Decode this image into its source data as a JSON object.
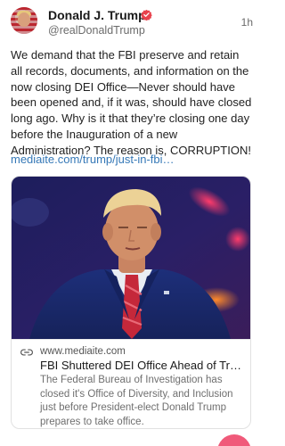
{
  "post": {
    "display_name": "Donald J. Trump",
    "handle": "@realDonaldTrump",
    "time": "1h",
    "text": "We demand that the FBI preserve and retain all records, documents, and information on the now closing DEI Office—Never should have been opened and, if it was, should have closed long ago. Why is it that they’re closing one day before the Inauguration of a new Administration? The reason is, CORRUPTION!",
    "link": "mediaite.com/trump/just-in-fbi…",
    "verified_icon": "verified-badge-icon"
  },
  "card": {
    "domain": "www.mediaite.com",
    "title": "FBI Shuttered DEI Office Ahead of Tru…",
    "description": "The Federal Bureau of Investigation has closed it's Office of Diversity, and Inclusion just before President-elect Donald Trump prepares to take office.",
    "link_icon": "link-icon"
  },
  "colors": {
    "accent_link": "#3578b7",
    "verified_badge": "#e8424d",
    "fab": "#f05a7a"
  }
}
